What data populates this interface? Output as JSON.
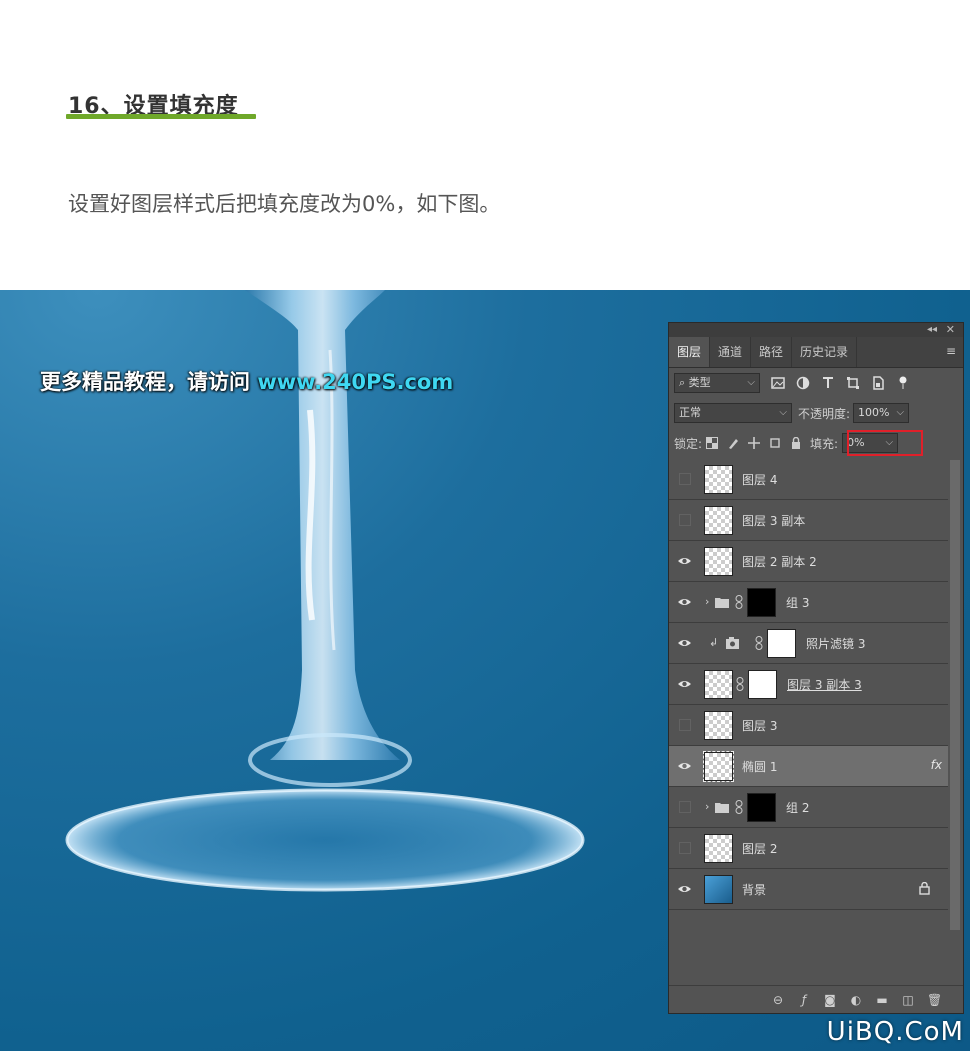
{
  "article": {
    "step_title": "16、设置填充度",
    "description": "设置好图层样式后把填充度改为0%，如下图。"
  },
  "artwork": {
    "promo_prefix": "更多精品教程，请访问",
    "promo_site": "www.240PS.com"
  },
  "panel": {
    "tabs": [
      "图层",
      "通道",
      "路径",
      "历史记录"
    ],
    "filter_kind": "类型",
    "blend_mode": "正常",
    "opacity_label": "不透明度:",
    "opacity_value": "100%",
    "lock_label": "锁定:",
    "fill_label": "填充:",
    "fill_value": "0%",
    "layers": [
      {
        "name": "图层 4",
        "visible": false
      },
      {
        "name": "图层 3 副本",
        "visible": false
      },
      {
        "name": "图层 2 副本 2",
        "visible": true
      },
      {
        "name": "组 3",
        "visible": true
      },
      {
        "name": "照片滤镜 3",
        "visible": true
      },
      {
        "name": "图层 3 副本 3",
        "visible": true
      },
      {
        "name": "图层 3",
        "visible": false
      },
      {
        "name": "椭圆 1",
        "visible": true,
        "selected": true,
        "fx": "fx"
      },
      {
        "name": "组 2",
        "visible": false
      },
      {
        "name": "图层 2",
        "visible": false
      },
      {
        "name": "背景",
        "visible": true
      }
    ]
  },
  "watermark": "UiBQ.CoM",
  "colors": {
    "accent_underline": "#6fa82a",
    "highlight": "#e0202a",
    "site_link": "#3fd8f2"
  }
}
